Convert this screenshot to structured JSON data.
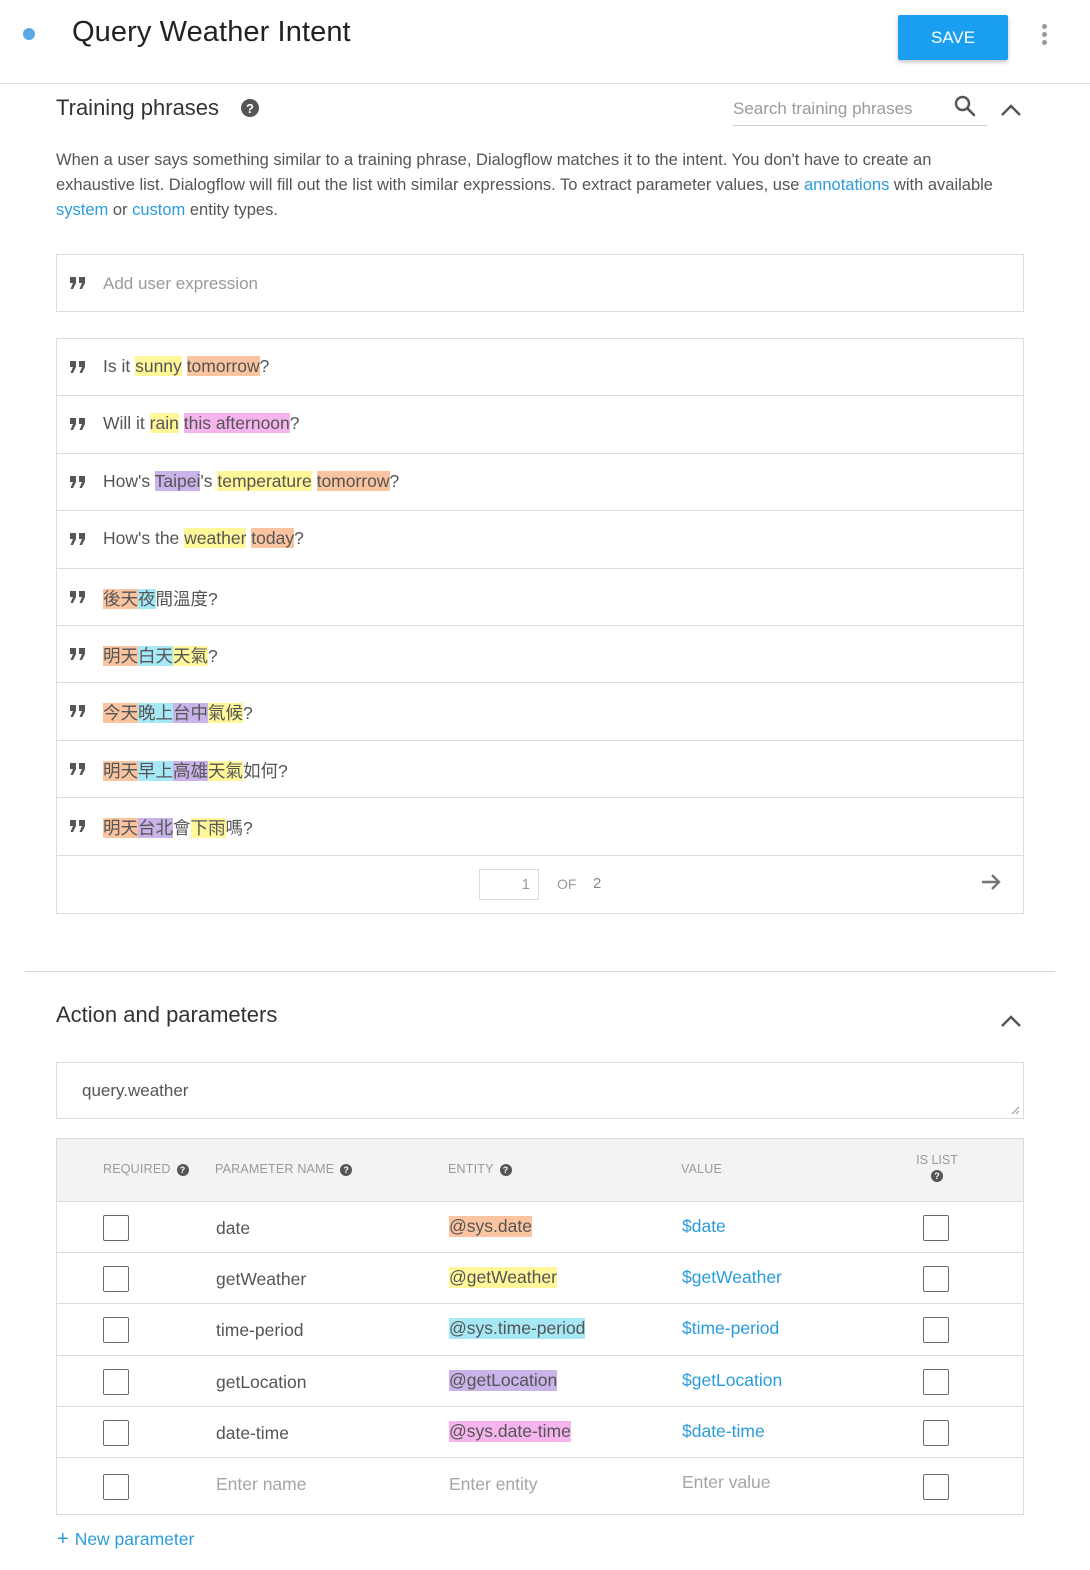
{
  "header": {
    "title": "Query Weather Intent",
    "save_label": "SAVE",
    "accent_color": "#1a9ff0"
  },
  "training": {
    "title": "Training phrases",
    "search_placeholder": "Search training phrases",
    "description": {
      "p1": "When a user says something similar to a training phrase, Dialogflow matches it to the intent. You don't have to create an exhaustive list. Dialogflow will fill out the list with similar expressions. To extract parameter values, use ",
      "link_annotations": "annotations",
      "p2": " with available ",
      "link_system": "system",
      "p3": " or ",
      "link_custom": "custom",
      "p4": " entity types."
    },
    "add_placeholder": "Add user expression",
    "phrases": [
      [
        {
          "t": "Is it "
        },
        {
          "t": "sunny",
          "c": "yellow"
        },
        {
          "t": " "
        },
        {
          "t": "tomorrow",
          "c": "orange"
        },
        {
          "t": "?"
        }
      ],
      [
        {
          "t": "Will it "
        },
        {
          "t": "rain",
          "c": "yellow"
        },
        {
          "t": " "
        },
        {
          "t": "this afternoon",
          "c": "pink"
        },
        {
          "t": "?"
        }
      ],
      [
        {
          "t": "How's "
        },
        {
          "t": "Taipei",
          "c": "purple"
        },
        {
          "t": "'s "
        },
        {
          "t": "temperature",
          "c": "yellow"
        },
        {
          "t": " "
        },
        {
          "t": "tomorrow",
          "c": "orange"
        },
        {
          "t": "?"
        }
      ],
      [
        {
          "t": "How's the "
        },
        {
          "t": "weather",
          "c": "yellow"
        },
        {
          "t": " "
        },
        {
          "t": "today",
          "c": "orange"
        },
        {
          "t": "?"
        }
      ],
      [
        {
          "t": "後天",
          "c": "orange"
        },
        {
          "t": "夜",
          "c": "cyan"
        },
        {
          "t": "間溫度"
        },
        {
          "t": "?"
        }
      ],
      [
        {
          "t": "明天",
          "c": "orange"
        },
        {
          "t": "白天",
          "c": "cyan"
        },
        {
          "t": "天氣",
          "c": "yellow"
        },
        {
          "t": "?"
        }
      ],
      [
        {
          "t": "今天",
          "c": "orange"
        },
        {
          "t": "晚上",
          "c": "cyan"
        },
        {
          "t": "台中",
          "c": "purple"
        },
        {
          "t": "氣候",
          "c": "yellow"
        },
        {
          "t": "?"
        }
      ],
      [
        {
          "t": "明天",
          "c": "orange"
        },
        {
          "t": "早上",
          "c": "cyan"
        },
        {
          "t": "高雄",
          "c": "purple"
        },
        {
          "t": "天氣",
          "c": "yellow"
        },
        {
          "t": "如何?"
        }
      ],
      [
        {
          "t": "明天",
          "c": "orange"
        },
        {
          "t": "台北",
          "c": "purple"
        },
        {
          "t": "會"
        },
        {
          "t": "下雨",
          "c": "yellow"
        },
        {
          "t": "嗎?"
        }
      ]
    ],
    "pager": {
      "current": "1",
      "of_label": "OF",
      "total": "2"
    },
    "highlight_colors": {
      "yellow": "#fff79a",
      "orange": "#f9c49f",
      "pink": "#f5b4ee",
      "purple": "#c9b3e8",
      "cyan": "#a6e8f5"
    }
  },
  "action": {
    "title": "Action and parameters",
    "value": "query.weather"
  },
  "params": {
    "headers": {
      "required": "REQUIRED",
      "name": "PARAMETER NAME",
      "entity": "ENTITY",
      "value": "VALUE",
      "is_list": "IS LIST"
    },
    "rows": [
      {
        "name": "date",
        "entity": "@sys.date",
        "entity_color": "orange",
        "value": "$date"
      },
      {
        "name": "getWeather",
        "entity": "@getWeather",
        "entity_color": "yellow",
        "value": "$getWeather"
      },
      {
        "name": "time-period",
        "entity": "@sys.time-period",
        "entity_color": "cyan",
        "value": "$time-period"
      },
      {
        "name": "getLocation",
        "entity": "@getLocation",
        "entity_color": "purple",
        "value": "$getLocation"
      },
      {
        "name": "date-time",
        "entity": "@sys.date-time",
        "entity_color": "pink",
        "value": "$date-time"
      }
    ],
    "empty_row": {
      "name_placeholder": "Enter name",
      "entity_placeholder": "Enter entity",
      "value_placeholder": "Enter value"
    },
    "new_param_label": "New parameter"
  }
}
